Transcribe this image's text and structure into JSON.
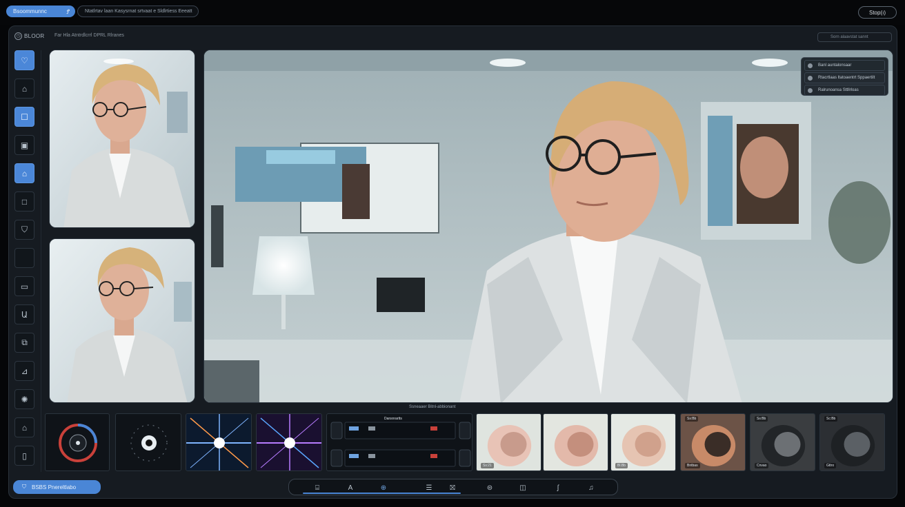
{
  "top": {
    "primary_pill": "Bsoommunnc",
    "primary_icon": "Ꝭ",
    "secondary_pill": "Ntatlrtav laan Kasysrnat srtvaat e Sldlrtiess Eeeatt",
    "right_button": "Stop(ı)"
  },
  "window": {
    "clock_icon": "◷",
    "brand": "BLOOR",
    "subtitle": "Far Hla Atntrdlcrrl DPRL Rlranes",
    "search_placeholder": "Sorn alaavstat sannt"
  },
  "sidebar": {
    "icons": [
      "heart-icon",
      "home-icon",
      "chat-icon",
      "camera-icon",
      "cloud-icon",
      "square-icon",
      "shield-icon",
      "blank-icon",
      "frame-icon",
      "trash-icon",
      "copy-icon",
      "stamp-icon",
      "settings-icon",
      "bell-icon",
      "phone-icon"
    ],
    "glyphs": [
      "♡",
      "⌂",
      "☐",
      "▣",
      "⌂",
      "□",
      "⛉",
      "",
      "▭",
      "Ա",
      "⧉",
      "⊿",
      "✺",
      "⌂",
      "▯"
    ],
    "active_indices": [
      0,
      2,
      4
    ]
  },
  "overlay": {
    "rows": [
      {
        "label": "Banl auntalonsaar"
      },
      {
        "label": "Rtacrtlaas ltatoaentrt Sppaertilt"
      },
      {
        "label": "Ralrunoansa Sttllrloas"
      }
    ]
  },
  "caption": "Ssneaaer Bitnl-abbionant",
  "strip": {
    "tiles": [
      {
        "type": "dial",
        "name": "dial-tile-red-blue"
      },
      {
        "type": "dial",
        "name": "dial-tile-lens"
      },
      {
        "type": "flare",
        "name": "flare-tile-blue"
      },
      {
        "type": "flare",
        "name": "flare-tile-purple"
      },
      {
        "type": "rack",
        "name": "signal-rack-tile",
        "header": "Dansnrartts"
      },
      {
        "type": "photo",
        "name": "photo-tile-coral-1",
        "label": "Ss:21"
      },
      {
        "type": "photo",
        "name": "photo-tile-coral-2",
        "label": ""
      },
      {
        "type": "photo",
        "name": "photo-tile-coral-3",
        "label": "Bl.Bb"
      },
      {
        "type": "photo",
        "name": "photo-tile-object",
        "label": "Bntbas",
        "tag": "Ss:Bb"
      },
      {
        "type": "photo",
        "name": "photo-tile-portrait-dark-1",
        "label": "Cnvao",
        "tag": "Ss:Bb"
      },
      {
        "type": "photo",
        "name": "photo-tile-portrait-dark-2",
        "label": "Gttro",
        "tag": "Sc:Bb"
      }
    ]
  },
  "bottom": {
    "status_icon": "⛉",
    "status_label": "BSBS Pnereltlabo",
    "tools": [
      "⌸",
      "A",
      "⊕",
      "☰",
      "⛝",
      "⊜",
      "◫",
      "ʃ",
      "♫"
    ],
    "tool_names": [
      "layers-tool-icon",
      "text-tool-icon",
      "effects-tool-icon",
      "list-tool-icon",
      "transform-tool-icon",
      "mask-tool-icon",
      "crop-tool-icon",
      "curve-tool-icon",
      "audio-tool-icon"
    ],
    "progress": 0.48
  }
}
